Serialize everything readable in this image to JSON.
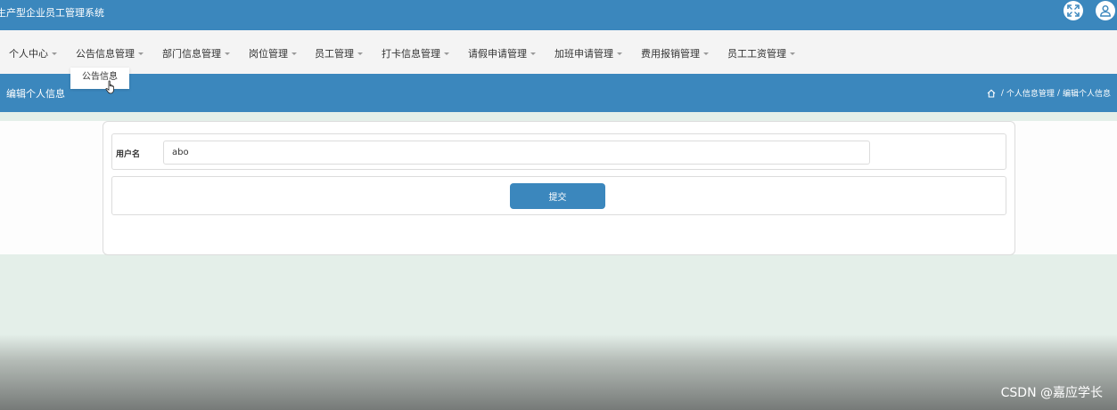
{
  "header": {
    "system_title": "生产型企业员工管理系统",
    "icons": [
      "fullscreen-icon",
      "user-icon"
    ]
  },
  "nav": {
    "items": [
      {
        "label": "个人中心"
      },
      {
        "label": "公告信息管理"
      },
      {
        "label": "部门信息管理"
      },
      {
        "label": "岗位管理"
      },
      {
        "label": "员工管理"
      },
      {
        "label": "打卡信息管理"
      },
      {
        "label": "请假申请管理"
      },
      {
        "label": "加班申请管理"
      },
      {
        "label": "费用报销管理"
      },
      {
        "label": "员工工资管理"
      }
    ],
    "dropdown_item": "公告信息"
  },
  "page": {
    "title": "编辑个人信息",
    "breadcrumb": [
      "个人信息管理",
      "编辑个人信息"
    ],
    "breadcrumb_separator": "/"
  },
  "form": {
    "username_label": "用户名",
    "username_value": "abo",
    "submit_label": "提交"
  },
  "watermark": "CSDN @嘉应学长",
  "colors": {
    "primary": "#3b87bd",
    "nav_bg": "#f4f4f4",
    "page_bg": "#e4efe9"
  }
}
